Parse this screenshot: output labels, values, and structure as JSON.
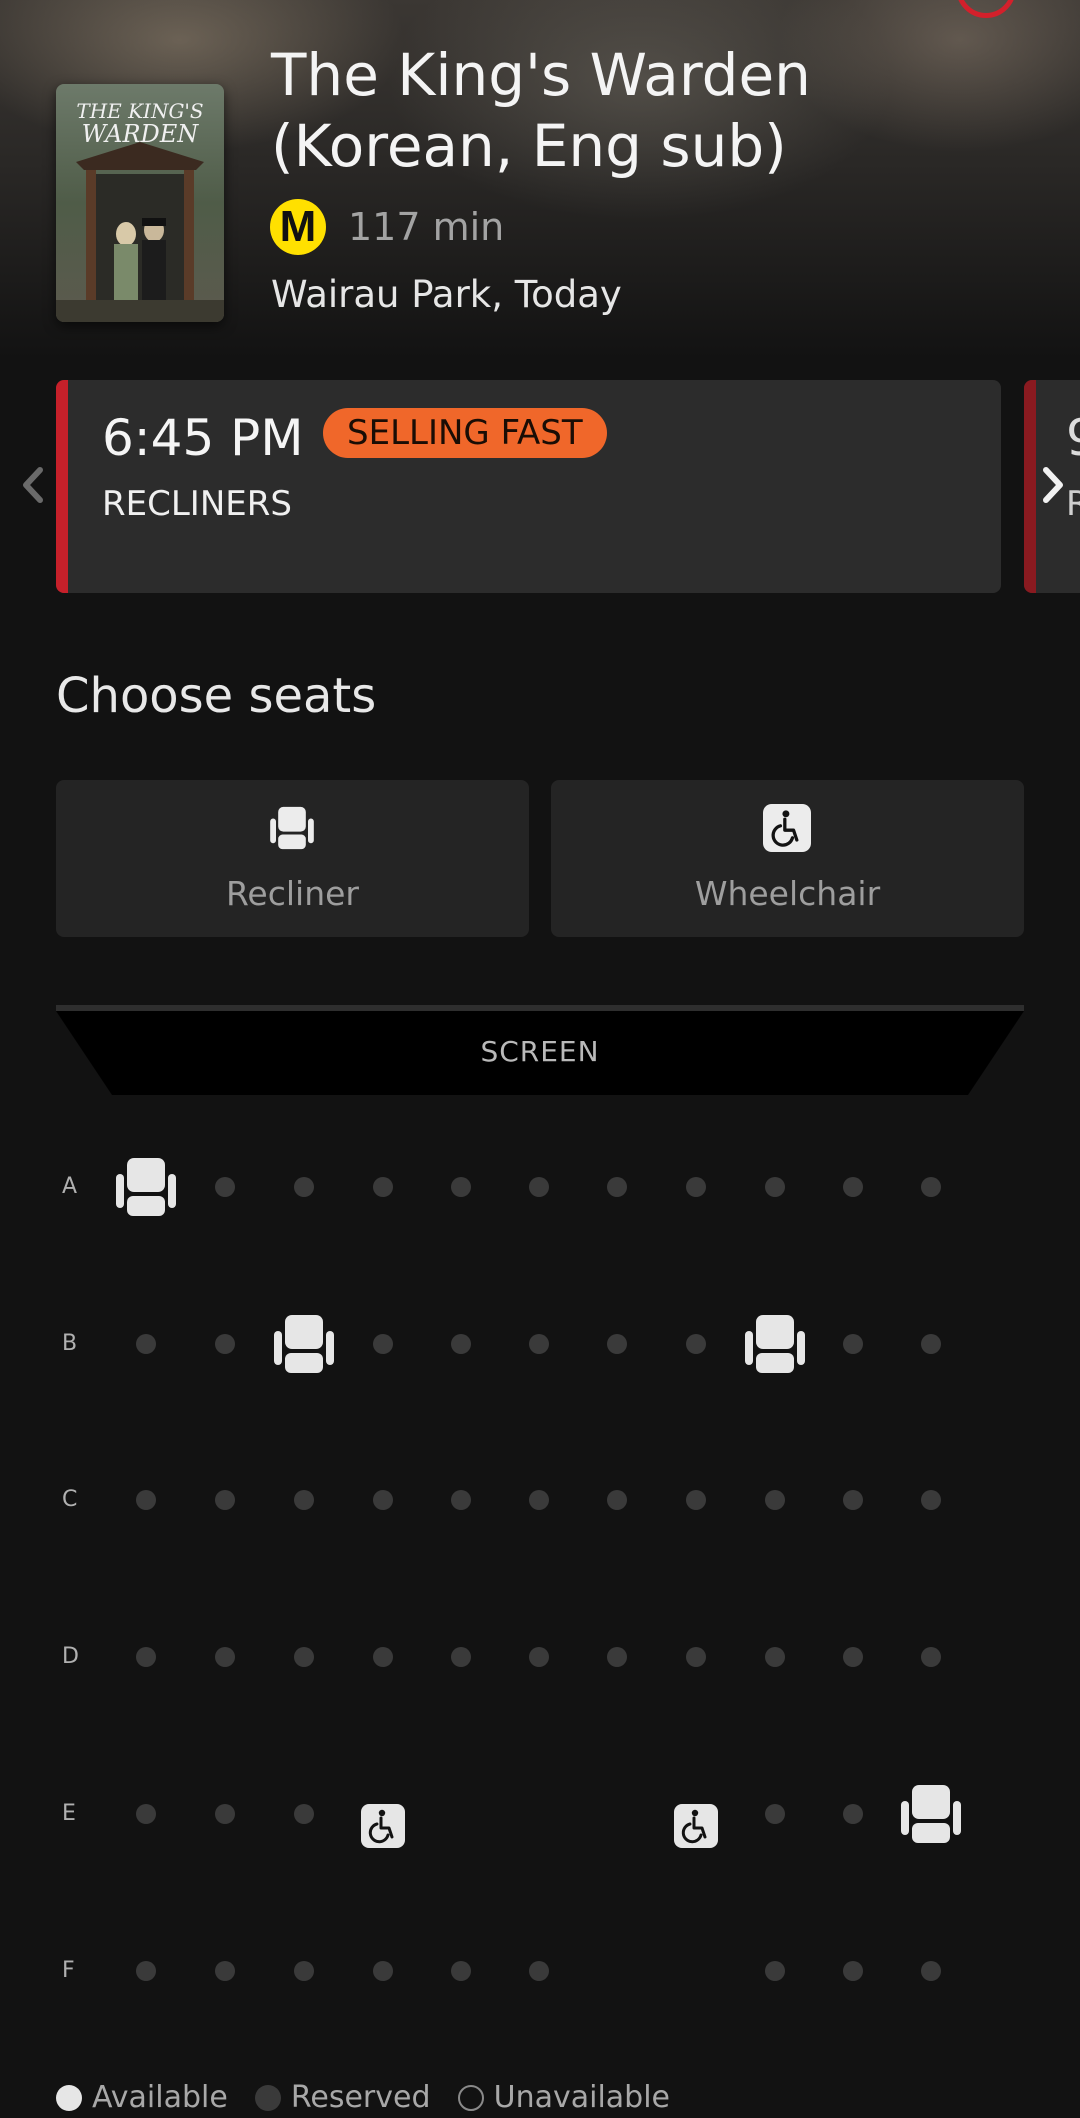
{
  "movie": {
    "title_line1": "The King's Warden",
    "title_line2": "(Korean, Eng sub)",
    "rating": "M",
    "runtime": "117 min",
    "location": "Wairau Park, Today",
    "poster_title_line1": "THE KING'S",
    "poster_title_line2": "WARDEN"
  },
  "sessions": [
    {
      "time": "6:45 PM",
      "badge": "SELLING FAST",
      "format": "RECLINERS",
      "selected": true
    },
    {
      "time": "9",
      "format": "R",
      "selected": false
    }
  ],
  "seat_section": {
    "heading": "Choose seats",
    "filters": [
      {
        "label": "Recliner",
        "icon": "recliner-seat-icon"
      },
      {
        "label": "Wheelchair",
        "icon": "wheelchair-icon"
      }
    ],
    "screen_label": "SCREEN"
  },
  "seat_map": {
    "rows": [
      {
        "label": "A",
        "seats": [
          "recliner",
          "dot",
          "dot",
          "dot",
          "dot",
          "dot",
          "dot",
          "dot",
          "dot",
          "dot",
          "dot"
        ]
      },
      {
        "label": "B",
        "seats": [
          "dot",
          "dot",
          "recliner",
          "dot",
          "dot",
          "dot",
          "dot",
          "dot",
          "recliner",
          "dot",
          "dot"
        ]
      },
      {
        "label": "C",
        "seats": [
          "dot",
          "dot",
          "dot",
          "dot",
          "dot",
          "dot",
          "dot",
          "dot",
          "dot",
          "dot",
          "dot"
        ]
      },
      {
        "label": "D",
        "seats": [
          "dot",
          "dot",
          "dot",
          "dot",
          "dot",
          "dot",
          "dot",
          "dot",
          "dot",
          "dot",
          "dot"
        ]
      },
      {
        "label": "E",
        "seats": [
          "dot",
          "dot",
          "dot",
          "wheelchair",
          "empty",
          "empty",
          "empty",
          "wheelchair",
          "dot",
          "dot",
          "recliner"
        ]
      },
      {
        "label": "F",
        "seats": [
          "dot",
          "dot",
          "dot",
          "dot",
          "dot",
          "dot",
          "empty",
          "empty",
          "dot",
          "dot",
          "dot"
        ]
      }
    ]
  },
  "legend": [
    {
      "label": "Available",
      "style": "available"
    },
    {
      "label": "Reserved",
      "style": "reserved"
    },
    {
      "label": "Unavailable",
      "style": "unavailable"
    }
  ],
  "colors": {
    "background": "#121212",
    "accent_red": "#c6202a",
    "selling_fast": "#f0672a",
    "rating_yellow": "#ffe000",
    "seat_dot": "#3a3a3a",
    "seat_icon": "#e6e6e6"
  }
}
